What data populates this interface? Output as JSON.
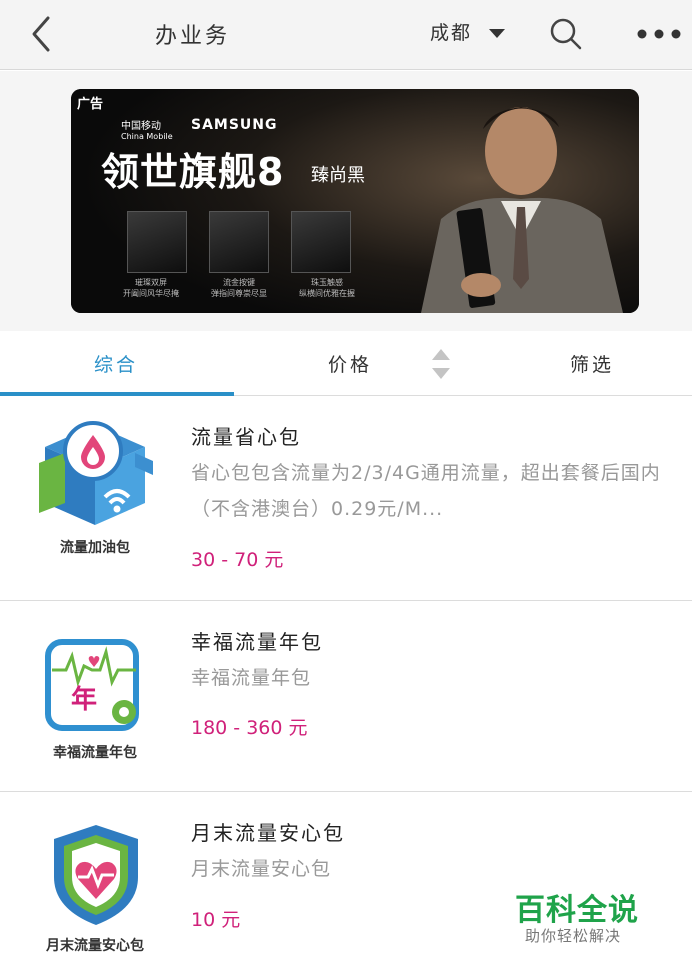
{
  "header": {
    "title": "办业务",
    "city": "成都",
    "icons": {
      "back": "chevron-left-icon",
      "caret": "caret-down-icon",
      "search": "search-icon",
      "more": "more-dots-icon"
    }
  },
  "banner": {
    "ad_tag": "广告",
    "brand_cn": "中国移动",
    "brand_en": "China Mobile",
    "brand_samsung": "SAMSUNG",
    "headline": "领世旗舰8",
    "subline": "臻尚黑",
    "captions": [
      "璀璨双屏\n开阖间风华尽掩",
      "流金按键\n弹指间尊崇尽显",
      "珠玉触感\n纵横间优雅在握"
    ]
  },
  "tabs": {
    "items": [
      "综合",
      "价格",
      "筛选"
    ],
    "active": "综合",
    "accent": "#2a90c8"
  },
  "list": [
    {
      "icon_caption": "流量加油包",
      "title": "流量省心包",
      "desc": "省心包包含流量为2/3/4G通用流量，超出套餐后国内（不含港澳台）0.29元/M...",
      "price": "30 - 70 元"
    },
    {
      "icon_caption": "幸福流量年包",
      "icon_label": "年",
      "title": "幸福流量年包",
      "desc": "幸福流量年包",
      "price": "180 - 360 元"
    },
    {
      "icon_caption": "月末流量安心包",
      "title": "月末流量安心包",
      "desc": "月末流量安心包",
      "price": "10 元"
    }
  ],
  "price_color": "#d0217a",
  "watermark": {
    "title": "百科全说",
    "subtitle": "助你轻松解决"
  }
}
